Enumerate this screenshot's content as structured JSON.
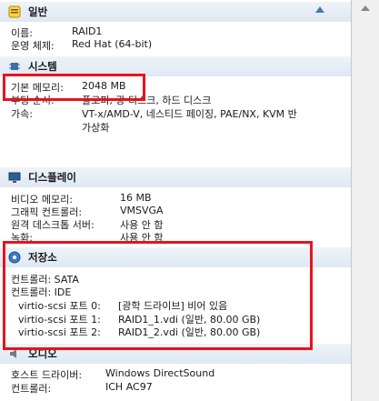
{
  "general": {
    "title": "일반",
    "rows": [
      {
        "k": "이름:",
        "v": "RAID1"
      },
      {
        "k": "운영 체제:",
        "v": "Red Hat (64-bit)"
      }
    ]
  },
  "system": {
    "title": "시스템",
    "rows": [
      {
        "k": "기본 메모리:",
        "v": "2048 MB"
      },
      {
        "k": "부팅 순서:",
        "v": "플로피, 광 디스크, 하드 디스크"
      },
      {
        "k": "가속:",
        "v": "VT-x/AMD-V, 네스티드 페이징, PAE/NX, KVM 반"
      },
      {
        "k": "",
        "v": "가상화"
      }
    ]
  },
  "display": {
    "title": "디스플레이",
    "rows": [
      {
        "k": "비디오 메모리:",
        "v": "16 MB"
      },
      {
        "k": "그래픽 컨트롤러:",
        "v": "VMSVGA"
      },
      {
        "k": "원격 데스크톱 서버:",
        "v": "사용 안 함"
      },
      {
        "k": "녹화:",
        "v": "사용 안 함"
      }
    ]
  },
  "storage": {
    "title": "저장소",
    "rows": [
      {
        "k": "컨트롤러: SATA",
        "v": ""
      },
      {
        "k": "컨트롤러: IDE",
        "v": ""
      },
      {
        "k": "virtio-scsi 포트 0:",
        "v": "[광학 드라이브] 비어 있음"
      },
      {
        "k": "virtio-scsi 포트 1:",
        "v": "RAID1_1.vdi (일반, 80.00 GB)"
      },
      {
        "k": "virtio-scsi 포트 2:",
        "v": "RAID1_2.vdi (일반, 80.00 GB)"
      }
    ]
  },
  "audio": {
    "title": "오디오",
    "rows": [
      {
        "k": "호스트 드라이버:",
        "v": "Windows DirectSound"
      },
      {
        "k": "컨트롤러:",
        "v": "ICH AC97"
      }
    ]
  },
  "colors": {
    "highlight": "#e8121e",
    "header": "#dfe8f3"
  }
}
